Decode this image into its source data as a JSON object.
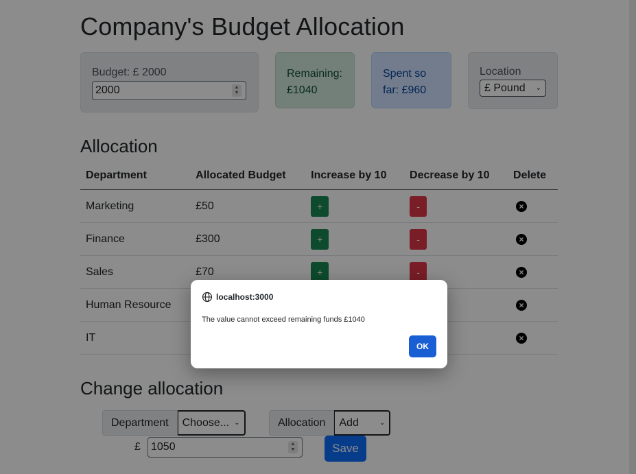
{
  "page_title": "Company's Budget Allocation",
  "budget": {
    "label": "Budget: £ 2000",
    "value": "2000"
  },
  "remaining": "Remaining: £1040",
  "spent": "Spent so far: £960",
  "location": {
    "label": "Location",
    "selected": "£ Pound"
  },
  "allocation": {
    "heading": "Allocation",
    "columns": [
      "Department",
      "Allocated Budget",
      "Increase by 10",
      "Decrease by 10",
      "Delete"
    ],
    "rows": [
      {
        "department": "Marketing",
        "budget": "£50"
      },
      {
        "department": "Finance",
        "budget": "£300"
      },
      {
        "department": "Sales",
        "budget": "£70"
      },
      {
        "department": "Human Resource",
        "budget": ""
      },
      {
        "department": "IT",
        "budget": ""
      }
    ],
    "inc_label": "+",
    "dec_label": "-"
  },
  "change": {
    "heading": "Change allocation",
    "department_label": "Department",
    "department_selected": "Choose...",
    "allocation_label": "Allocation",
    "allocation_selected": "Add",
    "currency": "£",
    "amount": "1050",
    "save_label": "Save"
  },
  "dialog": {
    "origin": "localhost:3000",
    "message": "The value cannot exceed remaining funds  £1040",
    "ok_label": "OK"
  },
  "colors": {
    "increase": "#198754",
    "decrease": "#dc3545",
    "primary": "#0d6efd"
  }
}
